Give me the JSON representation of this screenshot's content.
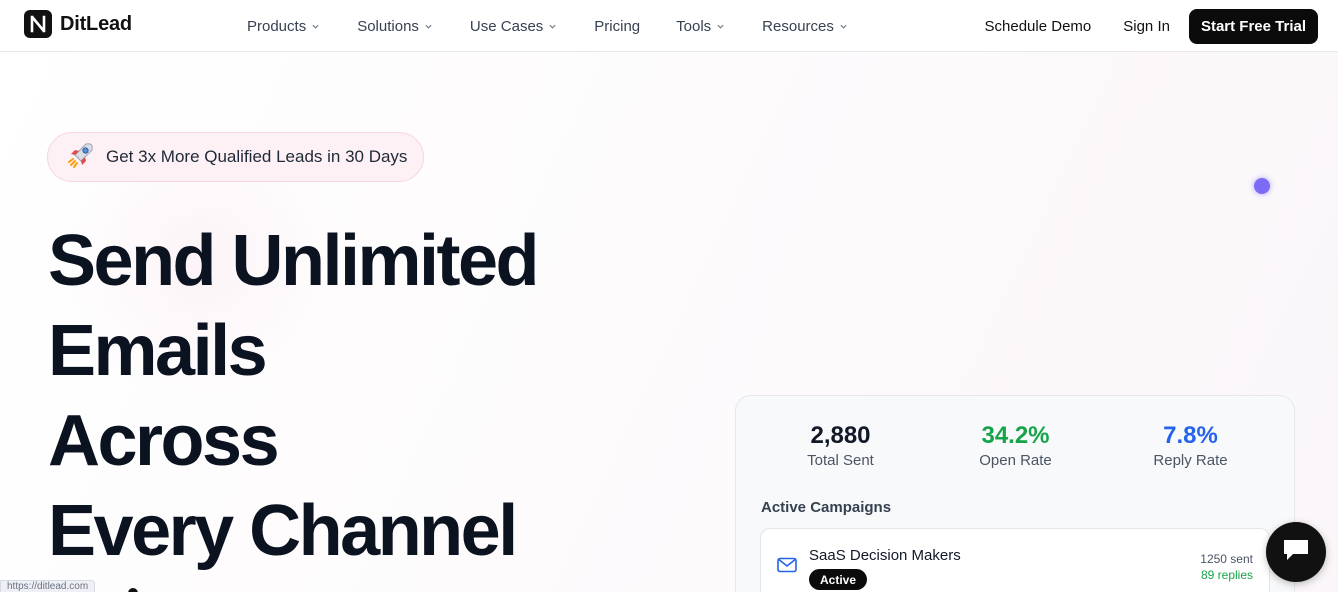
{
  "brand": {
    "name": "DitLead"
  },
  "nav": {
    "items": [
      {
        "label": "Products",
        "has_dropdown": true
      },
      {
        "label": "Solutions",
        "has_dropdown": true
      },
      {
        "label": "Use Cases",
        "has_dropdown": true
      },
      {
        "label": "Pricing",
        "has_dropdown": false
      },
      {
        "label": "Tools",
        "has_dropdown": true
      },
      {
        "label": "Resources",
        "has_dropdown": true
      }
    ],
    "schedule_demo": "Schedule Demo",
    "sign_in": "Sign In",
    "cta": "Start Free Trial"
  },
  "hero": {
    "badge_icon": "rocket-icon",
    "badge_text": "Get 3x More Qualified Leads in 30 Days",
    "headline": [
      "Send Unlimited",
      "Emails",
      "Across",
      "Every Channel"
    ]
  },
  "stats_card": {
    "stats": [
      {
        "value": "2,880",
        "label": "Total Sent",
        "color": "#111827"
      },
      {
        "value": "34.2%",
        "label": "Open Rate",
        "color": "#16a34a"
      },
      {
        "value": "7.8%",
        "label": "Reply Rate",
        "color": "#2563eb"
      }
    ],
    "section_title": "Active Campaigns",
    "campaigns": [
      {
        "name": "SaaS Decision Makers",
        "status": "Active",
        "sent": "1250 sent",
        "replies": "89 replies",
        "icon": "mail-icon"
      }
    ]
  },
  "chat": {
    "icon": "chat-bubble-icon"
  },
  "status_bar": {
    "url": "https://ditlead.com"
  },
  "colors": {
    "accent_dot": "#7c6cf5",
    "badge_bg": "#fdf1f5",
    "primary": "#0b0b0b"
  }
}
